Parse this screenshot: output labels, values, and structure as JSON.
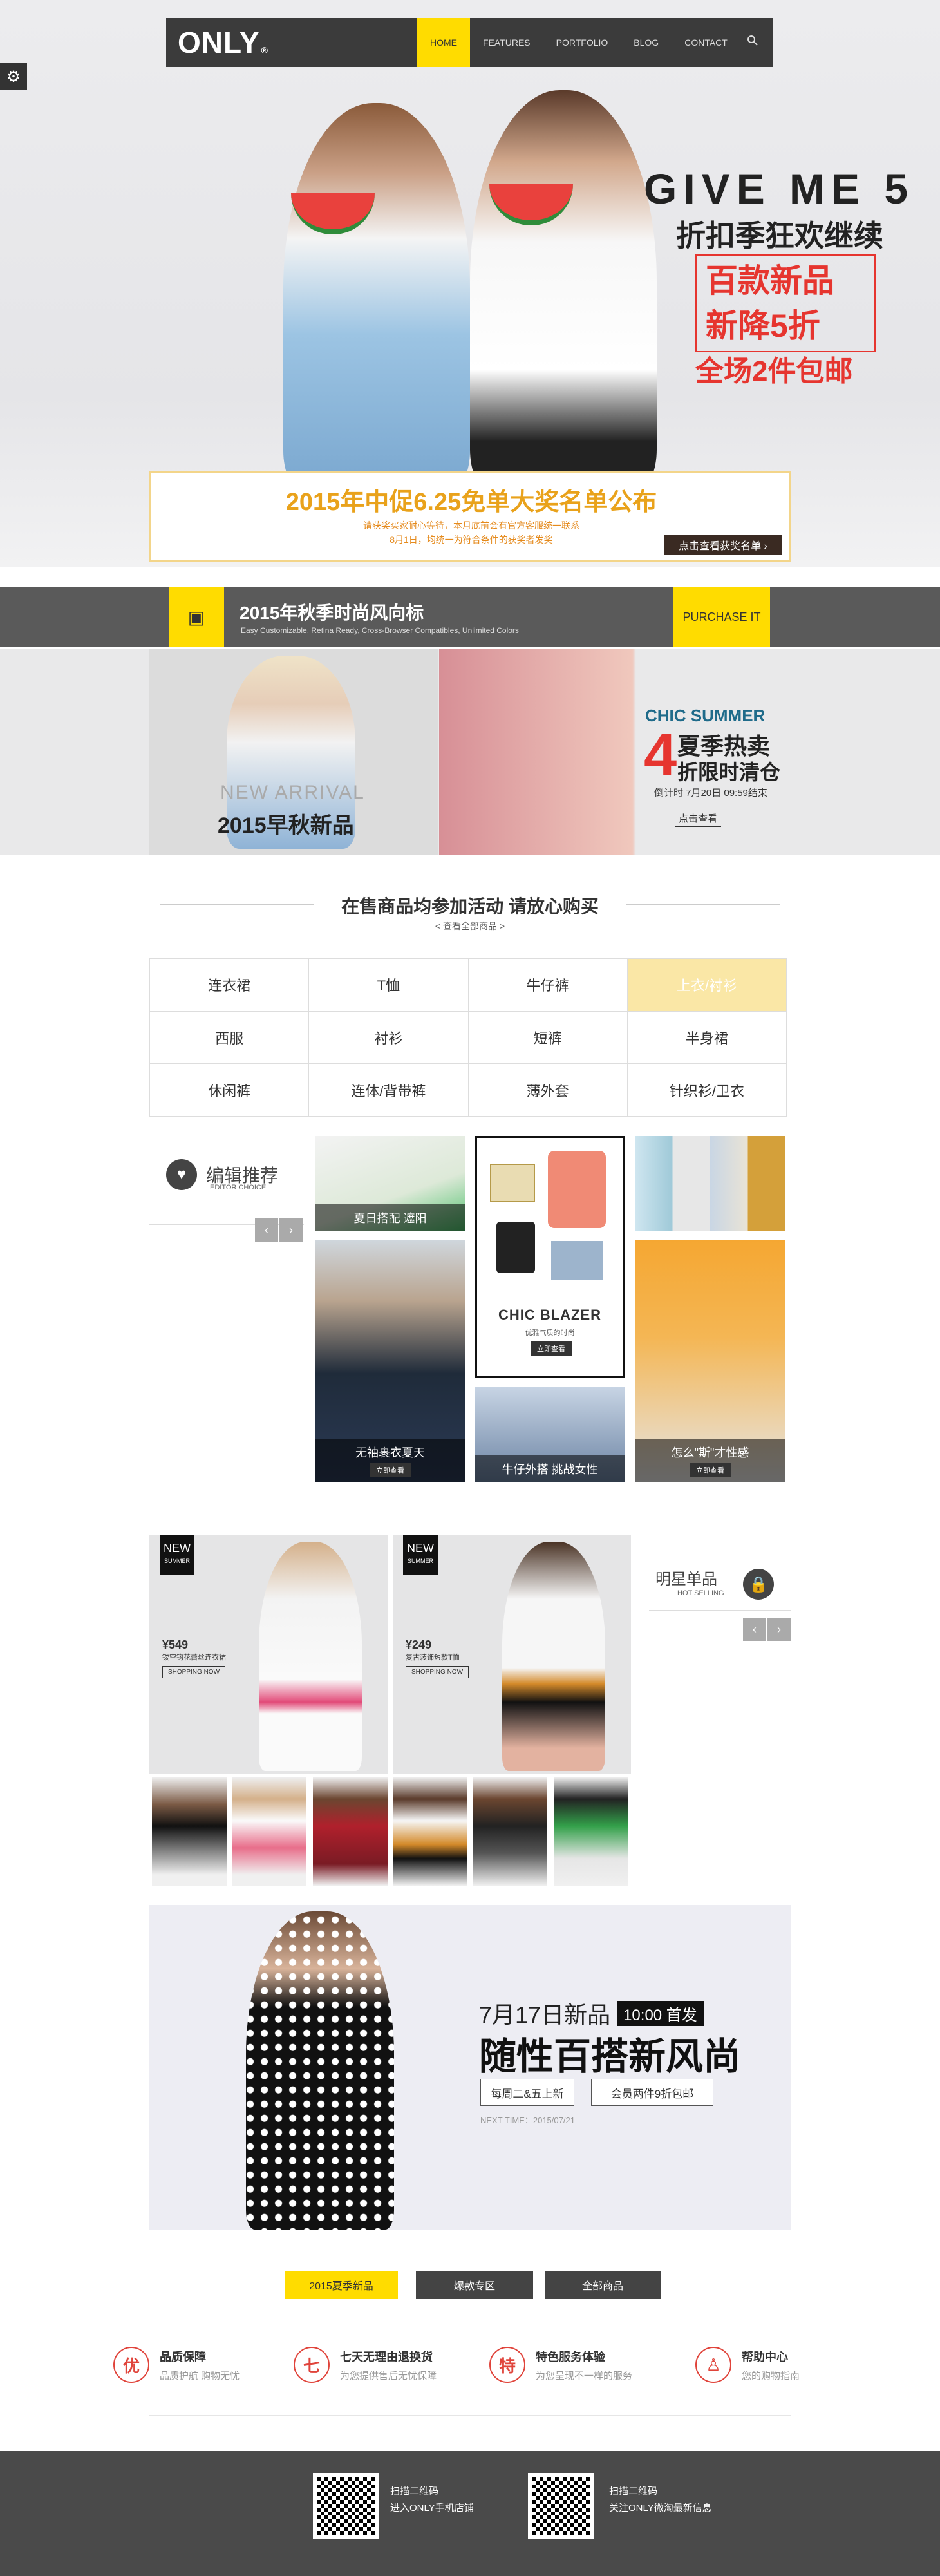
{
  "header": {
    "logo": "ONLY",
    "logo_mark": "®",
    "nav": [
      "HOME",
      "FEATURES",
      "PORTFOLIO",
      "BLOG",
      "CONTACT"
    ]
  },
  "hero": {
    "line1": "GIVE ME 5",
    "line2": "折扣季狂欢继续",
    "line3a": "百款新品",
    "line3b": "新降5折",
    "line4": "全场2件包邮"
  },
  "notice": {
    "title": "2015年中促6.25免单大奖名单公布",
    "sub1": "请获奖买家耐心等待，本月底前会有官方客服统一联系",
    "sub2": "8月1日，均统一为符合条件的获奖者发奖",
    "button": "点击查看获奖名单 ›"
  },
  "season": {
    "title": "2015年秋季时尚风向标",
    "sub": "Easy Customizable, Retina Ready, Cross-Browser Compatibles, Unlimited Colors",
    "button": "PURCHASE IT"
  },
  "banner_left": {
    "en": "NEW ARRIVAL",
    "title": "2015早秋新品"
  },
  "banner_right": {
    "en": "CHIC SUMMER",
    "num": "4",
    "line1": "夏季热卖",
    "line2": "折限时清仓",
    "countdown": "倒计时 7月20日 09:59结束",
    "button": "点击查看"
  },
  "categories": {
    "title": "在售商品均参加活动 请放心购买",
    "sub": "< 查看全部商品 >",
    "items": [
      "连衣裙",
      "T恤",
      "牛仔裤",
      "上衣/衬衫",
      "西服",
      "衬衫",
      "短裤",
      "半身裙",
      "休闲裤",
      "连体/背带裤",
      "薄外套",
      "针织衫/卫衣"
    ]
  },
  "editor": {
    "title": "编辑推荐",
    "sub": "EDITOR CHOICE",
    "prev": "‹",
    "next": "›",
    "tile1": "夏日搭配 遮阳",
    "tile2": "无袖裹衣夏天",
    "tile2_btn": "立即查看",
    "tile3_title": "CHIC BLAZER",
    "tile3_sub": "优雅气质的时尚",
    "tile3_btn": "立即查看",
    "tile4": "牛仔外搭 挑战女性",
    "tile5": "怎么\"斯\"才性感",
    "tile5_btn": "立即查看"
  },
  "hot": {
    "title": "明星单品",
    "sub": "HOT SELLING",
    "prev": "‹",
    "next": "›",
    "products": [
      {
        "tag": "NEW",
        "tag_sub": "SUMMER",
        "price": "¥549",
        "desc": "镂空钩花蕾丝连衣裙",
        "btn": "SHOPPING NOW"
      },
      {
        "tag": "NEW",
        "tag_sub": "SUMMER",
        "price": "¥249",
        "desc": "复古装饰短款T恤",
        "btn": "SHOPPING NOW"
      }
    ]
  },
  "promo": {
    "date": "7月17日新品",
    "badge": "10:00 首发",
    "title": "随性百搭新风尚",
    "btn1": "每周二&五上新",
    "btn2": "会员两件9折包邮",
    "time": "NEXT TIME：2015/07/21"
  },
  "tabs": [
    "2015夏季新品",
    "爆款专区",
    "全部商品"
  ],
  "services": [
    {
      "icon": "优",
      "title": "品质保障",
      "sub": "品质护航 购物无忧"
    },
    {
      "icon": "七",
      "title": "七天无理由退换货",
      "sub": "为您提供售后无忧保障"
    },
    {
      "icon": "特",
      "title": "特色服务体验",
      "sub": "为您呈现不一样的服务"
    },
    {
      "icon": "♙",
      "title": "帮助中心",
      "sub": "您的购物指南"
    }
  ],
  "footer": [
    {
      "l1": "扫描二维码",
      "l2": "进入ONLY手机店铺"
    },
    {
      "l1": "扫描二维码",
      "l2": "关注ONLY微淘最新信息"
    }
  ],
  "colors": {
    "accent": "#ffdc00",
    "dark": "#3b3b3b",
    "red": "#e6352f"
  }
}
